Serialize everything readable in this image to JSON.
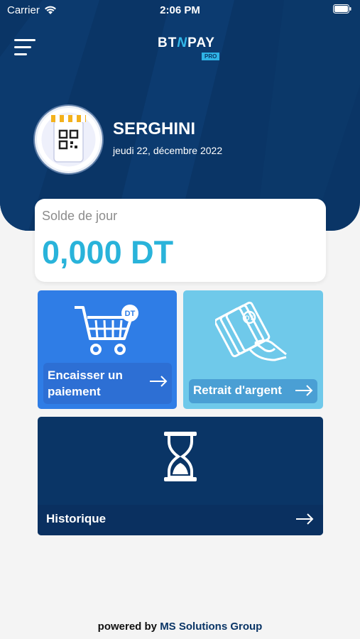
{
  "status_bar": {
    "carrier": "Carrier",
    "time": "2:06 PM"
  },
  "app": {
    "logo_text_left": "BT",
    "logo_text_n": "N",
    "logo_text_right": "PAY",
    "logo_badge": "PRO"
  },
  "profile": {
    "name": "SERGHINI",
    "date": "jeudi 22, décembre 2022",
    "avatar_icon": "qr-shop-icon"
  },
  "balance": {
    "label": "Solde de jour",
    "value": "0,000 DT"
  },
  "tiles": {
    "pay": {
      "label": "Encaisser un paiement",
      "icon": "cart-dt-icon"
    },
    "withdraw": {
      "label": "Retrait d'argent",
      "icon": "cash-hand-icon"
    },
    "history": {
      "label": "Historique",
      "icon": "hourglass-icon"
    }
  },
  "footer": {
    "prefix": "powered by",
    "company": "MS Solutions Group"
  },
  "colors": {
    "header_bg": "#0a3566",
    "accent_cyan": "#29b3da",
    "tile_pay": "#2f7de6",
    "tile_withdraw": "#6fc9ea",
    "tile_history": "#0a3566"
  }
}
